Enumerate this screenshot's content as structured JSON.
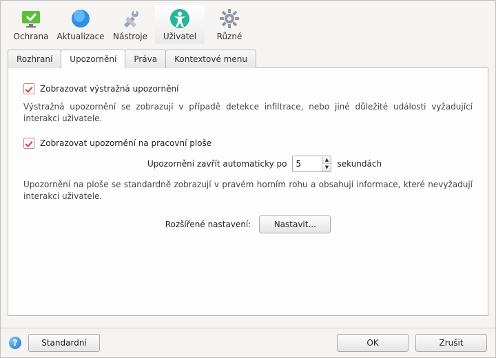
{
  "toolbar": {
    "items": [
      {
        "label": "Ochrana",
        "icon": "shield"
      },
      {
        "label": "Aktualizace",
        "icon": "globe"
      },
      {
        "label": "Nástroje",
        "icon": "tools"
      },
      {
        "label": "Uživatel",
        "icon": "user"
      },
      {
        "label": "Různé",
        "icon": "gear"
      }
    ],
    "selected": 3
  },
  "tabs": {
    "items": [
      "Rozhraní",
      "Upozornění",
      "Práva",
      "Kontextové menu"
    ],
    "active": 1
  },
  "pane": {
    "show_alerts_label": "Zobrazovat výstražná upozornění",
    "show_alerts_checked": true,
    "alerts_desc": "Výstražná upozornění se zobrazují v případě detekce infiltrace, nebo jiné důležité události vyžadující interakci uživatele.",
    "show_desktop_label": "Zobrazovat upozornění na pracovní ploše",
    "show_desktop_checked": true,
    "autoclose_prefix": "Upozornění zavřít automaticky po",
    "autoclose_value": "5",
    "autoclose_suffix": "sekundách",
    "desktop_desc": "Upozornění na ploše se standardně zobrazují v pravém horním rohu a obsahují informace, které nevyžadují interakci uživatele.",
    "advanced_label": "Rozšířené nastavení:",
    "advanced_button": "Nastavit..."
  },
  "footer": {
    "default_label": "Standardní",
    "ok_label": "OK",
    "cancel_label": "Zrušit"
  }
}
